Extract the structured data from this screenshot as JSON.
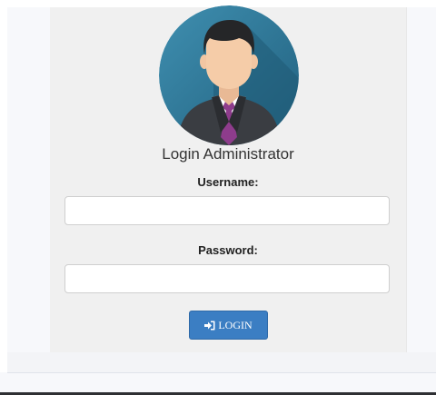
{
  "login": {
    "title": "Login Administrator",
    "username_label": "Username:",
    "username_value": "",
    "password_label": "Password:",
    "password_value": "",
    "button_label": "LOGIN",
    "button_icon": "sign-in-icon"
  },
  "colors": {
    "button": "#3b7ec3",
    "avatar_bg": "#2b6f8f",
    "panel": "#f0f0f0"
  }
}
